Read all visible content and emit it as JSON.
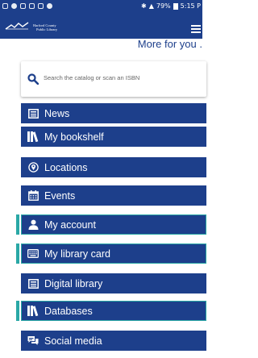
{
  "status_bar": {
    "battery": "79%",
    "time": "5:15 P"
  },
  "header": {
    "logo_line1": "Harford County",
    "logo_line2": "Public Library",
    "menu_icon": "hamburger-menu-icon"
  },
  "promo": {
    "text": "More for you ."
  },
  "search": {
    "placeholder": "Search the catalog or scan an ISBN",
    "icon": "search-icon"
  },
  "menu": {
    "items": [
      {
        "label": "News",
        "icon": "newspaper-icon"
      },
      {
        "label": "My bookshelf",
        "icon": "books-icon"
      },
      {
        "label": "Locations",
        "icon": "location-pin-icon"
      },
      {
        "label": "Events",
        "icon": "calendar-icon"
      },
      {
        "label": "My account",
        "icon": "user-icon"
      },
      {
        "label": "My library card",
        "icon": "keyboard-card-icon"
      },
      {
        "label": "Digital library",
        "icon": "newspaper-icon"
      },
      {
        "label": "Databases",
        "icon": "books-icon"
      },
      {
        "label": "Social media",
        "icon": "chat-bubbles-icon"
      }
    ]
  },
  "colors": {
    "brand_blue": "#1d3f8b",
    "accent_teal": "#2aa8a6"
  }
}
